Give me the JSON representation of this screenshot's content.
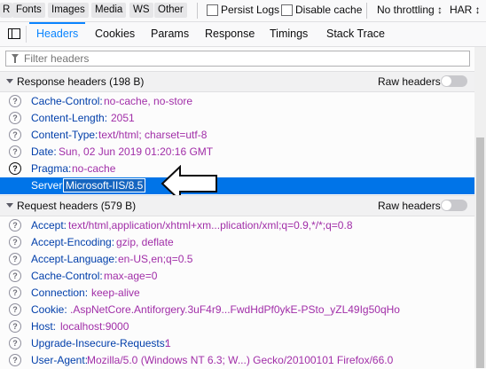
{
  "filter_bar": {
    "type_buttons": [
      "R",
      "Fonts",
      "Images",
      "Media",
      "WS",
      "Other"
    ],
    "persist_logs": "Persist Logs",
    "disable_cache": "Disable cache",
    "throttling": "No throttling ↕",
    "har": "HAR ↕"
  },
  "tabs": [
    "Headers",
    "Cookies",
    "Params",
    "Response",
    "Timings",
    "Stack Trace"
  ],
  "filter": {
    "placeholder": "Filter headers"
  },
  "response": {
    "title": "Response headers (198 B)",
    "raw_label": "Raw headers",
    "rows": [
      {
        "name": "Cache-Control:",
        "value": "no-cache, no-store"
      },
      {
        "name": "Content-Length:",
        "value": "2051"
      },
      {
        "name": "Content-Type:",
        "value": "text/html; charset=utf-8"
      },
      {
        "name": "Date:",
        "value": "Sun, 02 Jun 2019 01:20:16 GMT"
      },
      {
        "name": "Pragma:",
        "value": "no-cache"
      },
      {
        "name": "Server:",
        "value": "Microsoft-IIS/8.5"
      }
    ]
  },
  "request": {
    "title": "Request headers (579 B)",
    "raw_label": "Raw headers",
    "rows": [
      {
        "name": "Accept:",
        "value": "text/html,application/xhtml+xm...plication/xml;q=0.9,*/*;q=0.8"
      },
      {
        "name": "Accept-Encoding:",
        "value": "gzip, deflate"
      },
      {
        "name": "Accept-Language:",
        "value": "en-US,en;q=0.5"
      },
      {
        "name": "Cache-Control:",
        "value": "max-age=0"
      },
      {
        "name": "Connection:",
        "value": "keep-alive"
      },
      {
        "name": "Cookie:",
        "value": ".AspNetCore.Antiforgery.3uF4r9...FwdHdPf0ykE-PSto_yZL49Ig50qHo"
      },
      {
        "name": "Host:",
        "value": "localhost:9000"
      },
      {
        "name": "Upgrade-Insecure-Requests:",
        "value": "1"
      },
      {
        "name": "User-Agent:",
        "value": "Mozilla/5.0 (Windows NT 6.3; W...) Gecko/20100101 Firefox/66.0"
      }
    ]
  },
  "icons": {
    "info": "question-circle-icon",
    "dock": "dock-side-icon",
    "filter": "filter-icon",
    "callout": "left-arrow-icon"
  },
  "colors": {
    "accent": "#0a84ff",
    "selected_row": "#0074e8",
    "header_name": "#003eaa",
    "header_value": "#a12ea8"
  }
}
